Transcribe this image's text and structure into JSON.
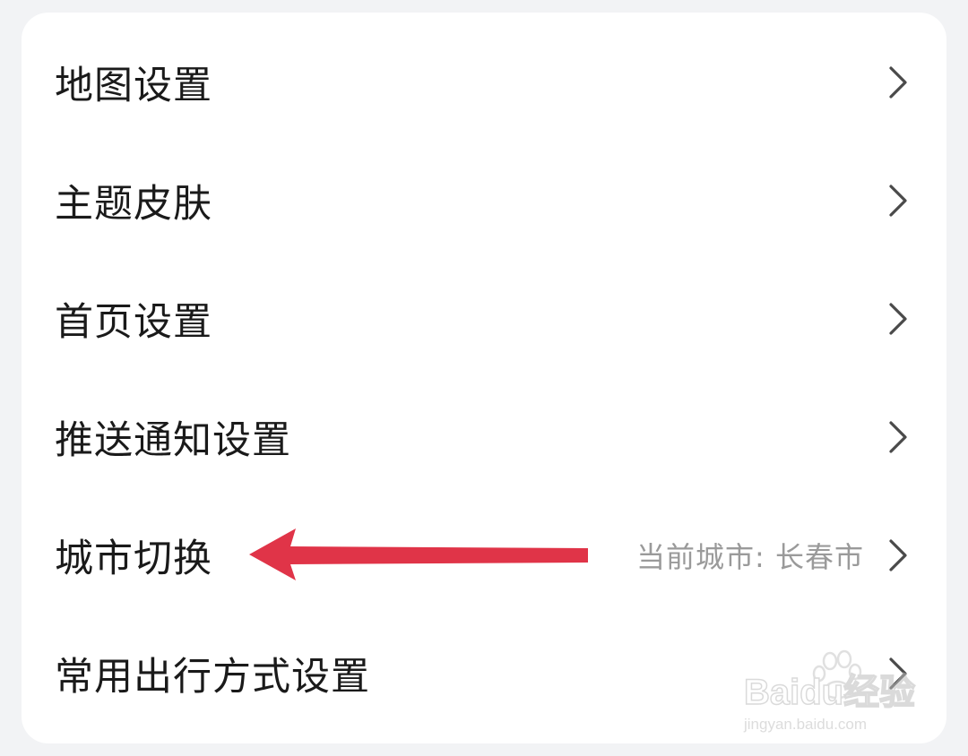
{
  "settings": {
    "items": [
      {
        "label": "地图设置",
        "value": ""
      },
      {
        "label": "主题皮肤",
        "value": ""
      },
      {
        "label": "首页设置",
        "value": ""
      },
      {
        "label": "推送通知设置",
        "value": ""
      },
      {
        "label": "城市切换",
        "value": "当前城市: 长春市"
      },
      {
        "label": "常用出行方式设置",
        "value": ""
      }
    ],
    "chevron_icon": "chevron-right-icon"
  },
  "annotation": {
    "arrow_color": "#e03448",
    "icon": "arrow-left-icon"
  },
  "watermark": {
    "logo_text": "Baidu经验",
    "url_text": "jingyan.baidu.com"
  },
  "colors": {
    "background": "#f2f3f5",
    "card": "#ffffff",
    "text": "#1a1a1a",
    "secondary_text": "#9a9a9a",
    "chevron": "#4a4a4a"
  }
}
